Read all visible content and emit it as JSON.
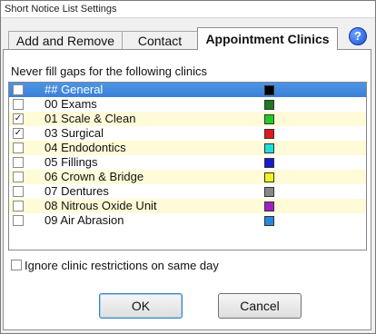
{
  "window": {
    "title": "Short Notice List Settings"
  },
  "tabs": [
    {
      "label": "Add and Remove"
    },
    {
      "label": "Contact"
    },
    {
      "label": "Appointment Clinics",
      "active": true
    }
  ],
  "help_icon": "help-icon",
  "panel": {
    "heading": "Never fill gaps for the following clinics",
    "clinics": [
      {
        "label": "## General",
        "checked": false,
        "color": "#000000",
        "selected": true
      },
      {
        "label": "00 Exams",
        "checked": false,
        "color": "#1e7a1e"
      },
      {
        "label": "01 Scale & Clean",
        "checked": true,
        "color": "#22cc22"
      },
      {
        "label": "03 Surgical",
        "checked": true,
        "color": "#dd1a1a"
      },
      {
        "label": "04 Endodontics",
        "checked": false,
        "color": "#22dddd"
      },
      {
        "label": "05 Fillings",
        "checked": false,
        "color": "#1a1ad0"
      },
      {
        "label": "06 Crown & Bridge",
        "checked": false,
        "color": "#f2f222"
      },
      {
        "label": "07 Dentures",
        "checked": false,
        "color": "#888888"
      },
      {
        "label": "08 Nitrous Oxide Unit",
        "checked": false,
        "color": "#a020c8"
      },
      {
        "label": "09 Air Abrasion",
        "checked": false,
        "color": "#2a88d8"
      }
    ],
    "ignore_label": "Ignore clinic restrictions on same day"
  },
  "buttons": {
    "ok": "OK",
    "cancel": "Cancel"
  }
}
